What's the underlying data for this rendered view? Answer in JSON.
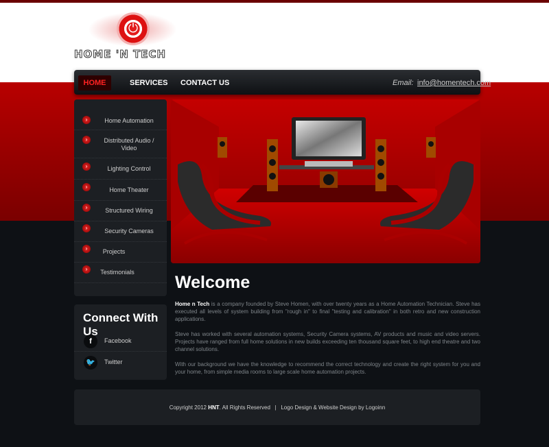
{
  "brand": {
    "logo_text": "HOME 'N TECH"
  },
  "nav": {
    "items": [
      {
        "label": "HOME",
        "active": true
      },
      {
        "label": "SERVICES",
        "active": false
      },
      {
        "label": "CONTACT US",
        "active": false
      }
    ],
    "email_label": "Email:",
    "email": "info@homentech.com"
  },
  "sidebar": {
    "items": [
      {
        "label": "Home Automation"
      },
      {
        "label": "Distributed Audio / Video"
      },
      {
        "label": "Lighting Control"
      },
      {
        "label": "Home Theater"
      },
      {
        "label": "Structured Wiring"
      },
      {
        "label": "Security Cameras"
      },
      {
        "label": "Projects"
      },
      {
        "label": "Testimonials"
      }
    ]
  },
  "connect": {
    "title": "Connect With Us",
    "links": [
      {
        "label": "Facebook",
        "icon": "facebook-icon"
      },
      {
        "label": "Twitter",
        "icon": "twitter-icon"
      }
    ]
  },
  "welcome": {
    "title": "Welcome",
    "p1_strong": "Home n Tech",
    "p1_rest": " is a company founded by Steve Homen, with over twenty years as a Home Automation Technician. Steve has executed all levels of system building from \"rough in\" to final \"testing and calibration\" in both retro and new construction applications.",
    "p2": "Steve has worked with several automation systems, Security Camera systems, AV products and music and video servers. Projects have ranged from full home solutions in new builds exceeding ten thousand square feet, to high end theatre and two channel solutions.",
    "p3": "With our background we have the knowledge to recommend the correct technology and create the right system for you and your home, from simple media rooms to large scale home automation projects."
  },
  "footer": {
    "copyright_prefix": "Copyright 2012",
    "brand_abbr": "HNT",
    "copyright_suffix": ". All Rights Reserved",
    "separator": "|",
    "credit": "Logo Design & Website Design by Logoinn"
  },
  "colors": {
    "accent_red": "#e31b1b",
    "dark_bg": "#0e1115",
    "panel_bg": "#1c1f23"
  }
}
